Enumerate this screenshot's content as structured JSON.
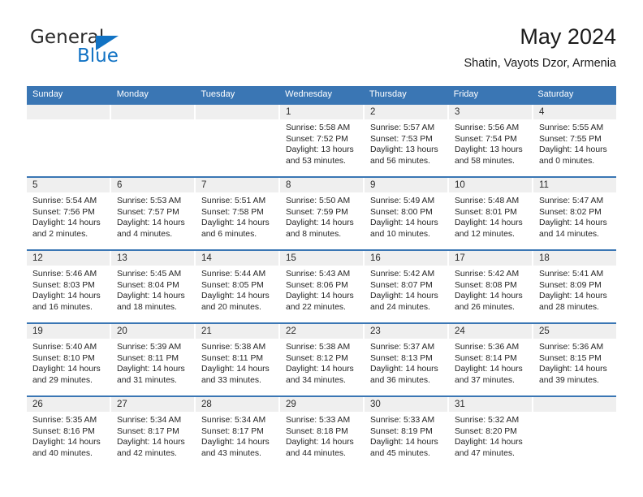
{
  "logo": {
    "word_one": "General",
    "word_two": "Blue",
    "triangle_icon": "triangle-icon",
    "brand_blue": "#1273c4"
  },
  "header": {
    "title": "May 2024",
    "subtitle": "Shatin, Vayots Dzor, Armenia"
  },
  "theme": {
    "header_blue": "#3a76b4",
    "day_number_gray": "#efefef",
    "text": "#262626"
  },
  "weekdays": [
    "Sunday",
    "Monday",
    "Tuesday",
    "Wednesday",
    "Thursday",
    "Friday",
    "Saturday"
  ],
  "weeks": [
    [
      {
        "day": "",
        "sunrise": "",
        "sunset": "",
        "daylight": "",
        "empty": true
      },
      {
        "day": "",
        "sunrise": "",
        "sunset": "",
        "daylight": "",
        "empty": true
      },
      {
        "day": "",
        "sunrise": "",
        "sunset": "",
        "daylight": "",
        "empty": true
      },
      {
        "day": "1",
        "sunrise": "Sunrise: 5:58 AM",
        "sunset": "Sunset: 7:52 PM",
        "daylight": "Daylight: 13 hours and 53 minutes."
      },
      {
        "day": "2",
        "sunrise": "Sunrise: 5:57 AM",
        "sunset": "Sunset: 7:53 PM",
        "daylight": "Daylight: 13 hours and 56 minutes."
      },
      {
        "day": "3",
        "sunrise": "Sunrise: 5:56 AM",
        "sunset": "Sunset: 7:54 PM",
        "daylight": "Daylight: 13 hours and 58 minutes."
      },
      {
        "day": "4",
        "sunrise": "Sunrise: 5:55 AM",
        "sunset": "Sunset: 7:55 PM",
        "daylight": "Daylight: 14 hours and 0 minutes."
      }
    ],
    [
      {
        "day": "5",
        "sunrise": "Sunrise: 5:54 AM",
        "sunset": "Sunset: 7:56 PM",
        "daylight": "Daylight: 14 hours and 2 minutes."
      },
      {
        "day": "6",
        "sunrise": "Sunrise: 5:53 AM",
        "sunset": "Sunset: 7:57 PM",
        "daylight": "Daylight: 14 hours and 4 minutes."
      },
      {
        "day": "7",
        "sunrise": "Sunrise: 5:51 AM",
        "sunset": "Sunset: 7:58 PM",
        "daylight": "Daylight: 14 hours and 6 minutes."
      },
      {
        "day": "8",
        "sunrise": "Sunrise: 5:50 AM",
        "sunset": "Sunset: 7:59 PM",
        "daylight": "Daylight: 14 hours and 8 minutes."
      },
      {
        "day": "9",
        "sunrise": "Sunrise: 5:49 AM",
        "sunset": "Sunset: 8:00 PM",
        "daylight": "Daylight: 14 hours and 10 minutes."
      },
      {
        "day": "10",
        "sunrise": "Sunrise: 5:48 AM",
        "sunset": "Sunset: 8:01 PM",
        "daylight": "Daylight: 14 hours and 12 minutes."
      },
      {
        "day": "11",
        "sunrise": "Sunrise: 5:47 AM",
        "sunset": "Sunset: 8:02 PM",
        "daylight": "Daylight: 14 hours and 14 minutes."
      }
    ],
    [
      {
        "day": "12",
        "sunrise": "Sunrise: 5:46 AM",
        "sunset": "Sunset: 8:03 PM",
        "daylight": "Daylight: 14 hours and 16 minutes."
      },
      {
        "day": "13",
        "sunrise": "Sunrise: 5:45 AM",
        "sunset": "Sunset: 8:04 PM",
        "daylight": "Daylight: 14 hours and 18 minutes."
      },
      {
        "day": "14",
        "sunrise": "Sunrise: 5:44 AM",
        "sunset": "Sunset: 8:05 PM",
        "daylight": "Daylight: 14 hours and 20 minutes."
      },
      {
        "day": "15",
        "sunrise": "Sunrise: 5:43 AM",
        "sunset": "Sunset: 8:06 PM",
        "daylight": "Daylight: 14 hours and 22 minutes."
      },
      {
        "day": "16",
        "sunrise": "Sunrise: 5:42 AM",
        "sunset": "Sunset: 8:07 PM",
        "daylight": "Daylight: 14 hours and 24 minutes."
      },
      {
        "day": "17",
        "sunrise": "Sunrise: 5:42 AM",
        "sunset": "Sunset: 8:08 PM",
        "daylight": "Daylight: 14 hours and 26 minutes."
      },
      {
        "day": "18",
        "sunrise": "Sunrise: 5:41 AM",
        "sunset": "Sunset: 8:09 PM",
        "daylight": "Daylight: 14 hours and 28 minutes."
      }
    ],
    [
      {
        "day": "19",
        "sunrise": "Sunrise: 5:40 AM",
        "sunset": "Sunset: 8:10 PM",
        "daylight": "Daylight: 14 hours and 29 minutes."
      },
      {
        "day": "20",
        "sunrise": "Sunrise: 5:39 AM",
        "sunset": "Sunset: 8:11 PM",
        "daylight": "Daylight: 14 hours and 31 minutes."
      },
      {
        "day": "21",
        "sunrise": "Sunrise: 5:38 AM",
        "sunset": "Sunset: 8:11 PM",
        "daylight": "Daylight: 14 hours and 33 minutes."
      },
      {
        "day": "22",
        "sunrise": "Sunrise: 5:38 AM",
        "sunset": "Sunset: 8:12 PM",
        "daylight": "Daylight: 14 hours and 34 minutes."
      },
      {
        "day": "23",
        "sunrise": "Sunrise: 5:37 AM",
        "sunset": "Sunset: 8:13 PM",
        "daylight": "Daylight: 14 hours and 36 minutes."
      },
      {
        "day": "24",
        "sunrise": "Sunrise: 5:36 AM",
        "sunset": "Sunset: 8:14 PM",
        "daylight": "Daylight: 14 hours and 37 minutes."
      },
      {
        "day": "25",
        "sunrise": "Sunrise: 5:36 AM",
        "sunset": "Sunset: 8:15 PM",
        "daylight": "Daylight: 14 hours and 39 minutes."
      }
    ],
    [
      {
        "day": "26",
        "sunrise": "Sunrise: 5:35 AM",
        "sunset": "Sunset: 8:16 PM",
        "daylight": "Daylight: 14 hours and 40 minutes."
      },
      {
        "day": "27",
        "sunrise": "Sunrise: 5:34 AM",
        "sunset": "Sunset: 8:17 PM",
        "daylight": "Daylight: 14 hours and 42 minutes."
      },
      {
        "day": "28",
        "sunrise": "Sunrise: 5:34 AM",
        "sunset": "Sunset: 8:17 PM",
        "daylight": "Daylight: 14 hours and 43 minutes."
      },
      {
        "day": "29",
        "sunrise": "Sunrise: 5:33 AM",
        "sunset": "Sunset: 8:18 PM",
        "daylight": "Daylight: 14 hours and 44 minutes."
      },
      {
        "day": "30",
        "sunrise": "Sunrise: 5:33 AM",
        "sunset": "Sunset: 8:19 PM",
        "daylight": "Daylight: 14 hours and 45 minutes."
      },
      {
        "day": "31",
        "sunrise": "Sunrise: 5:32 AM",
        "sunset": "Sunset: 8:20 PM",
        "daylight": "Daylight: 14 hours and 47 minutes."
      },
      {
        "day": "",
        "sunrise": "",
        "sunset": "",
        "daylight": "",
        "empty": true
      }
    ]
  ]
}
